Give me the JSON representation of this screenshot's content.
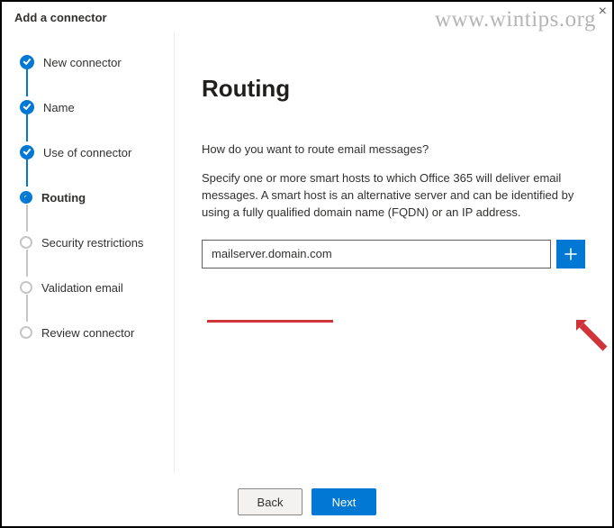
{
  "header": {
    "title": "Add a connector"
  },
  "watermark": "www.wintips.org",
  "sidebar": {
    "steps": [
      {
        "label": "New connector",
        "state": "completed"
      },
      {
        "label": "Name",
        "state": "completed"
      },
      {
        "label": "Use of connector",
        "state": "completed"
      },
      {
        "label": "Routing",
        "state": "current"
      },
      {
        "label": "Security restrictions",
        "state": "pending"
      },
      {
        "label": "Validation email",
        "state": "pending"
      },
      {
        "label": "Review connector",
        "state": "pending"
      }
    ]
  },
  "main": {
    "heading": "Routing",
    "question": "How do you want to route email messages?",
    "description": "Specify one or more smart hosts to which Office 365 will deliver email messages. A smart host is an alternative server and can be identified by using a fully qualified domain name (FQDN) or an IP address.",
    "host_input_value": "mailserver.domain.com",
    "add_button_name": "plus-icon"
  },
  "footer": {
    "back_label": "Back",
    "next_label": "Next"
  }
}
